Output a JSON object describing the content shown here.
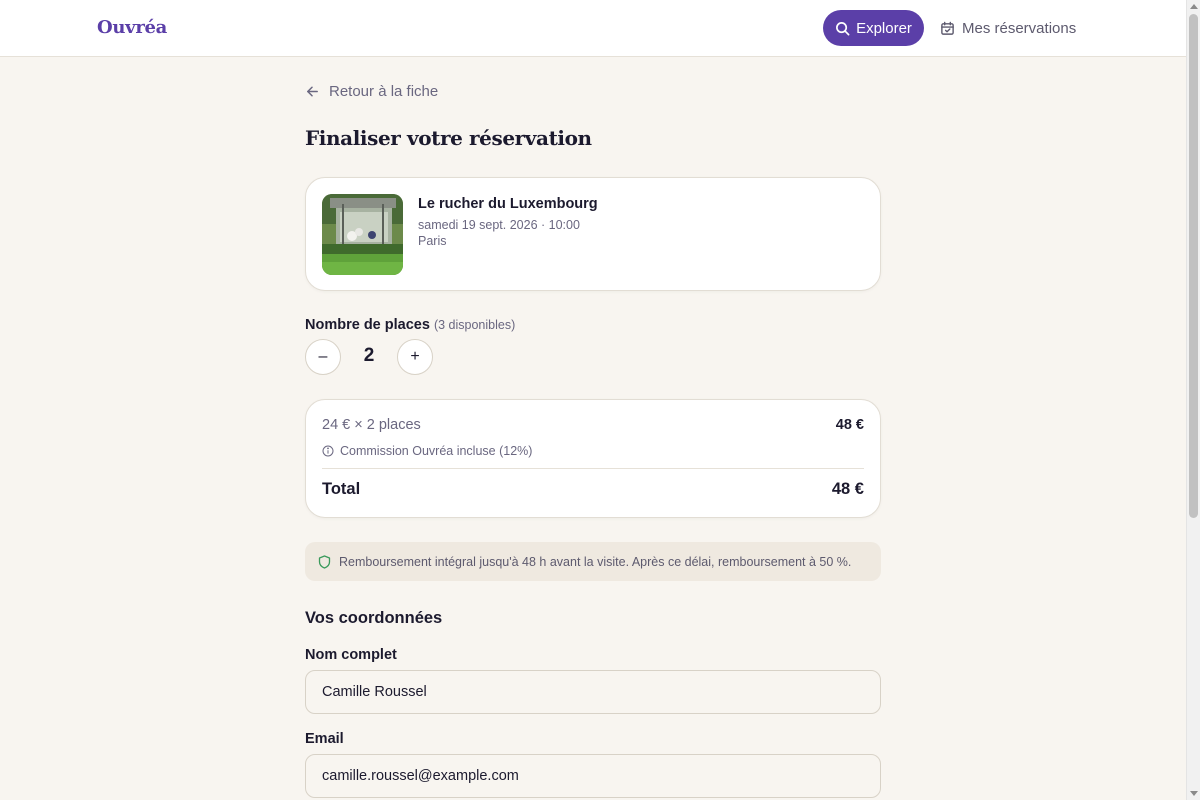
{
  "header": {
    "brand": "Ouvréa",
    "explore_label": "Explorer",
    "reservations_label": "Mes réservations"
  },
  "back_link": "Retour à la fiche",
  "page_title": "Finaliser votre réservation",
  "event": {
    "title": "Le rucher du Luxembourg",
    "datetime": "samedi 19 sept. 2026 · 10:00",
    "city": "Paris"
  },
  "places": {
    "label": "Nombre de places",
    "available": "(3 disponibles)",
    "minus": "–",
    "value": "2",
    "plus": "+"
  },
  "pricing": {
    "line_label": "24 € × 2 places",
    "line_amount": "48 €",
    "commission": "Commission Ouvréa incluse (12%)",
    "total_label": "Total",
    "total_amount": "48 €"
  },
  "refund_policy": "Remboursement intégral jusqu'à 48 h avant la visite. Après ce délai, remboursement à 50 %.",
  "contact": {
    "section_title": "Vos coordonnées",
    "name_label": "Nom complet",
    "name_value": "Camille Roussel",
    "email_label": "Email",
    "email_value": "camille.roussel@example.com"
  },
  "colors": {
    "accent": "#5b3fa8",
    "background": "#f8f5f0",
    "refund_icon": "#3a9a5b"
  },
  "icons": {
    "explore": "search-icon",
    "reservations": "calendar-check-icon",
    "back": "arrow-left-icon",
    "commission": "info-icon",
    "refund": "shield-icon"
  }
}
